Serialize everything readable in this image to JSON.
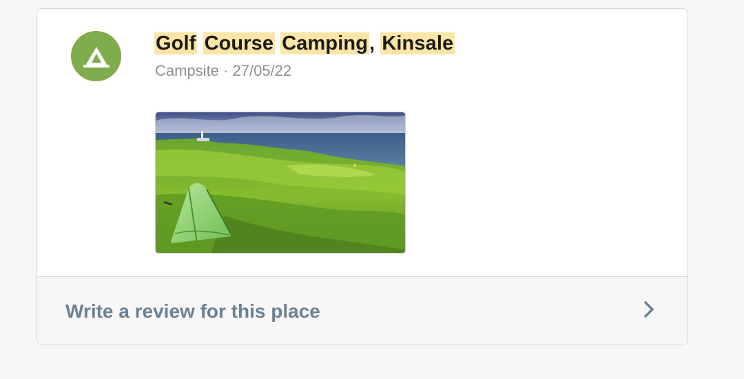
{
  "place": {
    "title_words": [
      "Golf",
      "Course",
      "Camping",
      "Kinsale"
    ],
    "title_separators": [
      " ",
      " ",
      ", "
    ],
    "category": "Campsite",
    "separator": "·",
    "date": "27/05/22",
    "icon": "tent-icon",
    "icon_color": "#7fad4d",
    "highlight_color": "#fde5a6",
    "photo_alt": "Tent on a grassy clifftop golf course overlooking the sea"
  },
  "review": {
    "label": "Write a review for this place",
    "icon": "chevron-right-icon"
  }
}
